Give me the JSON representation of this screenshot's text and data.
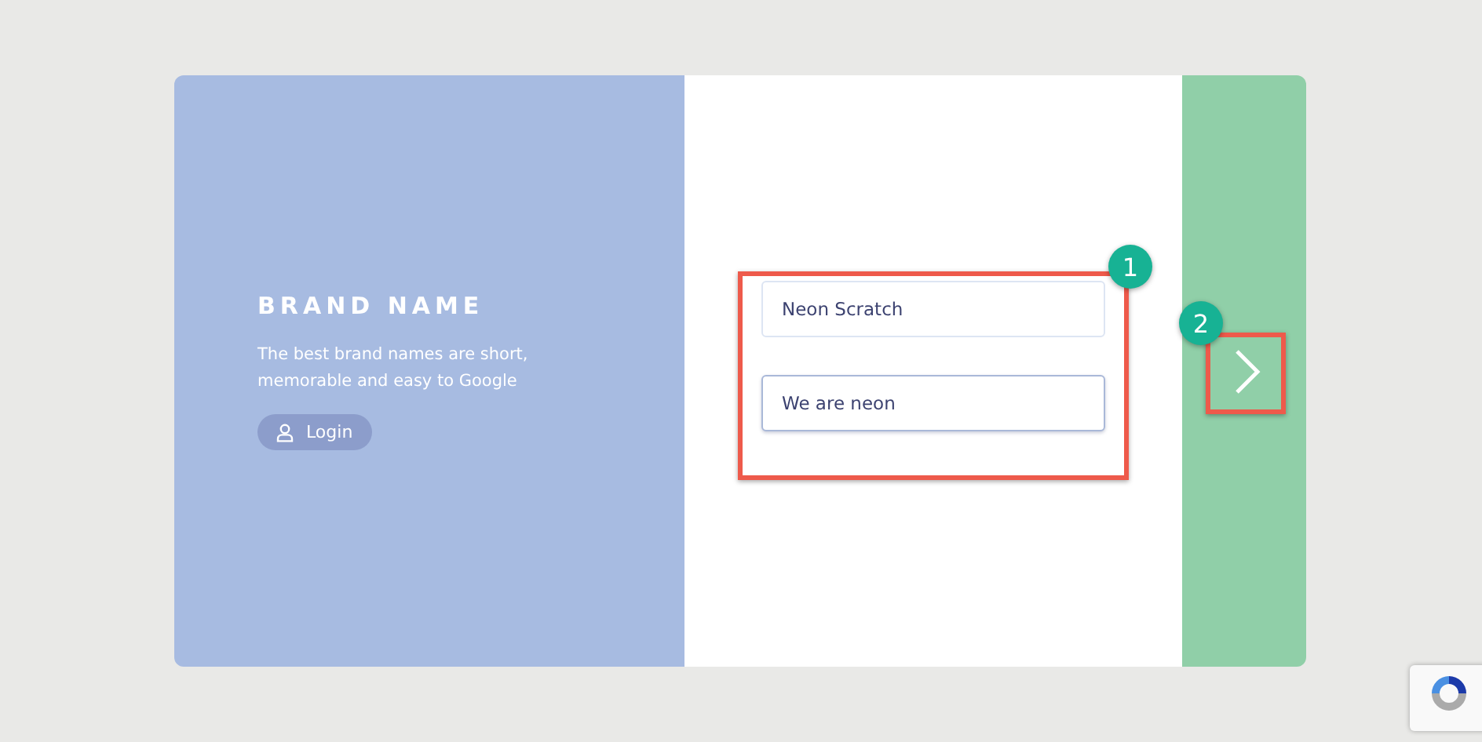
{
  "brand": {
    "title": "BRAND NAME",
    "tagline": "The best brand names are short, memorable and easy to Google",
    "login_button": "Login"
  },
  "fields": [
    {
      "value": "Neon Scratch",
      "focused": false
    },
    {
      "value": "We are neon",
      "focused": true
    }
  ],
  "annotations": [
    {
      "number": "1"
    },
    {
      "number": "2"
    }
  ]
}
